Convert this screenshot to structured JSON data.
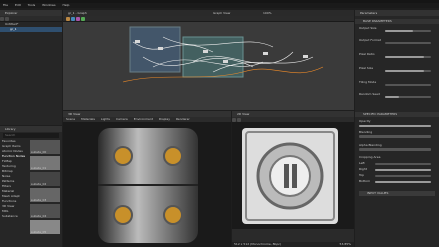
{
  "menu": [
    "File",
    "Edit",
    "Tools",
    "Windows",
    "Help"
  ],
  "explorer": {
    "title": "Explorer",
    "pkg": "Untitled*",
    "graph": "gr_1"
  },
  "graph": {
    "tab": "gr_1 - Graph",
    "view_label": "Graph View",
    "zoom": "100%"
  },
  "library": {
    "title": "Library",
    "search_placeholder": "Search",
    "folders": [
      "Favorites",
      "Graph Items",
      "Atomic Nodes",
      "Function Nodes",
      "FxMap",
      "Texturing",
      "Bitmap",
      "Noise",
      "Patterns",
      "Filters",
      "Material",
      "Mesh Adapt",
      "Functions",
      "3D View",
      "MDL",
      "Substance"
    ],
    "thumb_labels": [
      "substa_00",
      "substa_01",
      "substa_02",
      "substa_03",
      "substa_04",
      "substa_05"
    ]
  },
  "view3d": {
    "title": "3D View",
    "menu": [
      "Scene",
      "Materials",
      "Lights",
      "Camera",
      "Environment",
      "Display",
      "Renderer"
    ]
  },
  "view2d": {
    "title": "2D View",
    "status": "512 x 512 (Monochrome, 8bpc)",
    "zoom": "53.85%"
  },
  "params": {
    "title": "Parameters",
    "section1": "BASE PARAMETERS",
    "section2": "SPECIFIC PARAMETERS",
    "rows": [
      "Output Size",
      "Output Format",
      "Pixel Ratio",
      "Pixel Size",
      "Tiling Mode",
      "Random Seed"
    ],
    "rows2": [
      "Opacity",
      "Blending",
      "Dest. blend",
      "Alpha Blending",
      "Cropping Area",
      "Left",
      "Right",
      "Top",
      "Bottom"
    ],
    "presets": "INPUT VALUES"
  },
  "colors": {
    "accent": "#f28c28",
    "bg": "#1e1e1e",
    "panel": "#262626"
  }
}
